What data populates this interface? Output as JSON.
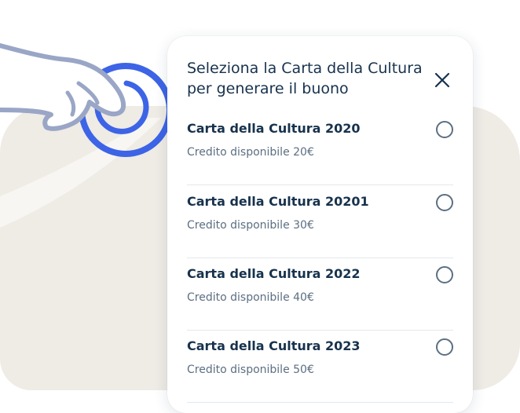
{
  "modal": {
    "title": "Seleziona la Carta della Cultura per generare il buono",
    "close_icon": "close-icon"
  },
  "cards": [
    {
      "name": "Carta della Cultura 2020",
      "credit": "Credito disponibile 20€",
      "selected": false
    },
    {
      "name": "Carta della Cultura 20201",
      "credit": "Credito disponibile 30€",
      "selected": false
    },
    {
      "name": "Carta della Cultura 2022",
      "credit": "Credito disponibile 40€",
      "selected": false
    },
    {
      "name": "Carta della Cultura 2023",
      "credit": "Credito disponibile 50€",
      "selected": false
    }
  ],
  "illustration": {
    "icon": "tapping-hand-icon",
    "accent_color": "#3d64e6",
    "outline_color": "#9aa6c6"
  }
}
